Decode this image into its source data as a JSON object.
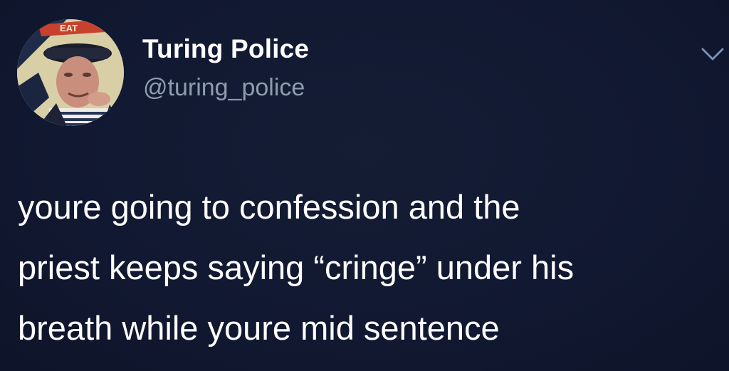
{
  "author": {
    "display_name": "Turing Police",
    "handle": "@turing_police",
    "avatar_text": "EAT"
  },
  "menu": {
    "icon": "chevron-down-icon"
  },
  "tweet": {
    "lines": [
      "youre going to confession and the",
      "priest keeps saying “cringe” under his",
      "breath while youre mid sentence"
    ]
  },
  "colors": {
    "background": "#121a30",
    "name": "#ffffff",
    "handle": "#8e9cae",
    "chevron": "#7a8fb4"
  }
}
